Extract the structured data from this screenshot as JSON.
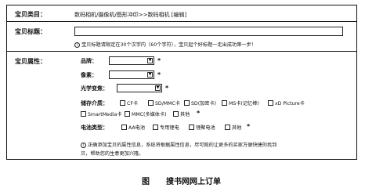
{
  "form": {
    "category_label": "宝贝类目：",
    "category_value": "数码相机/摄像机/图形冲印>>数码相机 [编辑]",
    "title_label": "宝贝标题：",
    "title_value": "",
    "title_hint": "宝贝标题请限定在30个汉字内（60个字符），宝贝起个好标题一走出成功第一步！",
    "attributes_label": "宝贝属性：",
    "brand_label": "品牌：",
    "brand_value": "",
    "pixel_label": "像素：",
    "pixel_value": "",
    "zoom_label": "光学变焦：",
    "zoom_value": "",
    "required_mark": "*",
    "storage_label": "储存介质：",
    "storage_options": [
      "CF卡",
      "SD/MMC卡",
      "SD(加密卡)",
      "MS卡(记忆棒)",
      "xD Picture卡",
      "SmartMedia卡",
      "MMC(多媒体卡)",
      "其他"
    ],
    "battery_label": "电池类型：",
    "battery_options": [
      "AA电池",
      "专用锂电",
      "锂聚电池",
      "其他"
    ],
    "footer_hint_line1": "正确添加宝贝的属性信息，系统将根据属性信息，尽可能的让更多的买家方便快捷的找到",
    "footer_hint_line2": "贝，帮助您的生意更加兴隆。"
  },
  "caption": {
    "figure_label": "图",
    "text": "搜书网网上订单"
  }
}
